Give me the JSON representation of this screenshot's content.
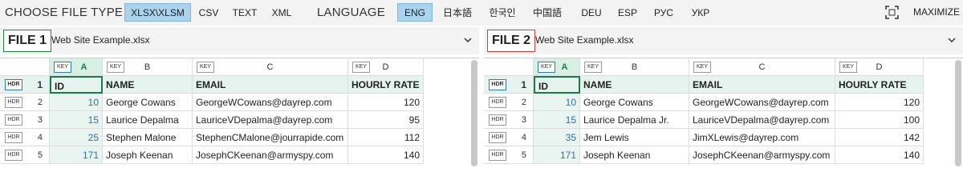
{
  "toolbar": {
    "choose_file_type_label": "CHOOSE FILE TYPE",
    "file_types": [
      "XLSX\\XLSM",
      "CSV",
      "TEXT",
      "XML"
    ],
    "file_type_selected": "XLSX\\XLSM",
    "language_label": "LANGUAGE",
    "languages": [
      "ENG",
      "日本語",
      "한국인",
      "中国語",
      "DEU",
      "ESP",
      "РУС",
      "УКР"
    ],
    "language_selected": "ENG",
    "maximize_label": "MAXIMIZE"
  },
  "panels": [
    {
      "file_label": "FILE 1",
      "file_name": "Web Site Example.xlsx",
      "key_badge": "KEY",
      "hdr_badge": "HDR",
      "columns": [
        "A",
        "B",
        "C",
        "D"
      ],
      "row_numbers": [
        "1",
        "2",
        "3",
        "4",
        "5"
      ],
      "headers": [
        "ID",
        "NAME",
        "EMAIL",
        "HOURLY RATE"
      ],
      "rows": [
        [
          "10",
          "George Cowans",
          "GeorgeWCowans@dayrep.com",
          "120"
        ],
        [
          "15",
          "Laurice Depalma",
          "LauriceVDepalma@dayrep.com",
          "95"
        ],
        [
          "25",
          "Stephen Malone",
          "StephenCMalone@jourrapide.com",
          "112"
        ],
        [
          "171",
          "Joseph Keenan",
          "JosephCKeenan@armyspy.com",
          "140"
        ]
      ]
    },
    {
      "file_label": "FILE 2",
      "file_name": "Web Site Example.xlsx",
      "key_badge": "KEY",
      "hdr_badge": "HDR",
      "columns": [
        "A",
        "B",
        "C",
        "D"
      ],
      "row_numbers": [
        "1",
        "2",
        "3",
        "4",
        "5"
      ],
      "headers": [
        "ID",
        "NAME",
        "EMAIL",
        "HOURLY RATE"
      ],
      "rows": [
        [
          "10",
          "George Cowans",
          "GeorgeWCowans@dayrep.com",
          "120"
        ],
        [
          "15",
          "Laurice Depalma Jr.",
          "LauriceVDepalma@dayrep.com",
          "100"
        ],
        [
          "35",
          "Jem Lewis",
          "JimXLewis@dayrep.com",
          "142"
        ],
        [
          "171",
          "Joseph Keenan",
          "JosephCKeenan@armyspy.com",
          "140"
        ]
      ]
    }
  ],
  "colors": {
    "selected_button": "#a9d3ef",
    "file1_border": "#1e8c3a",
    "file2_border": "#d83a3a",
    "key_column_fill": "#d7f0e4",
    "header_row_fill": "#e5f4ef",
    "id_text": "#2f6fb0"
  }
}
